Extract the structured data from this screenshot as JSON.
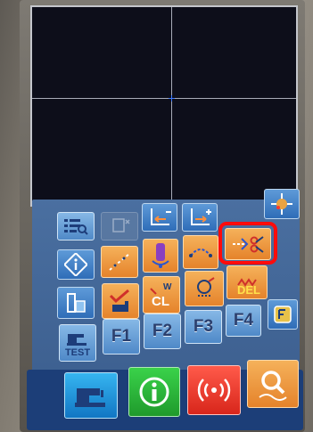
{
  "screen": {
    "title": ""
  },
  "colors": {
    "canvas_bg": "#0d0e1a",
    "crosshair": "#a8abb8",
    "cursor": "#3f7bff",
    "button_blue": "#2f6db8",
    "button_orange": "#e5832b",
    "highlight": "#ff0b0b"
  },
  "function_keys": {
    "f1": "F1",
    "f2": "F2",
    "f3": "F3",
    "f4": "F4"
  },
  "labels": {
    "test": "TEST",
    "cl": "CL",
    "w": "W",
    "del": "DEL"
  },
  "icons": [
    "pattern-list-icon",
    "menu-scroll-icon",
    "point-delete-icon",
    "point-add-icon",
    "origin-point-icon",
    "info-icon",
    "stitch-icon",
    "thread-clamp-icon",
    "feed-icon",
    "trim-icon",
    "shape-icon",
    "stitch-check-icon",
    "wiper-clamp-icon",
    "presser-icon",
    "delete-icon",
    "test-sewing-icon",
    "function-key-icon",
    "sewing-machine-icon",
    "information-icon",
    "communication-icon",
    "search-icon"
  ]
}
